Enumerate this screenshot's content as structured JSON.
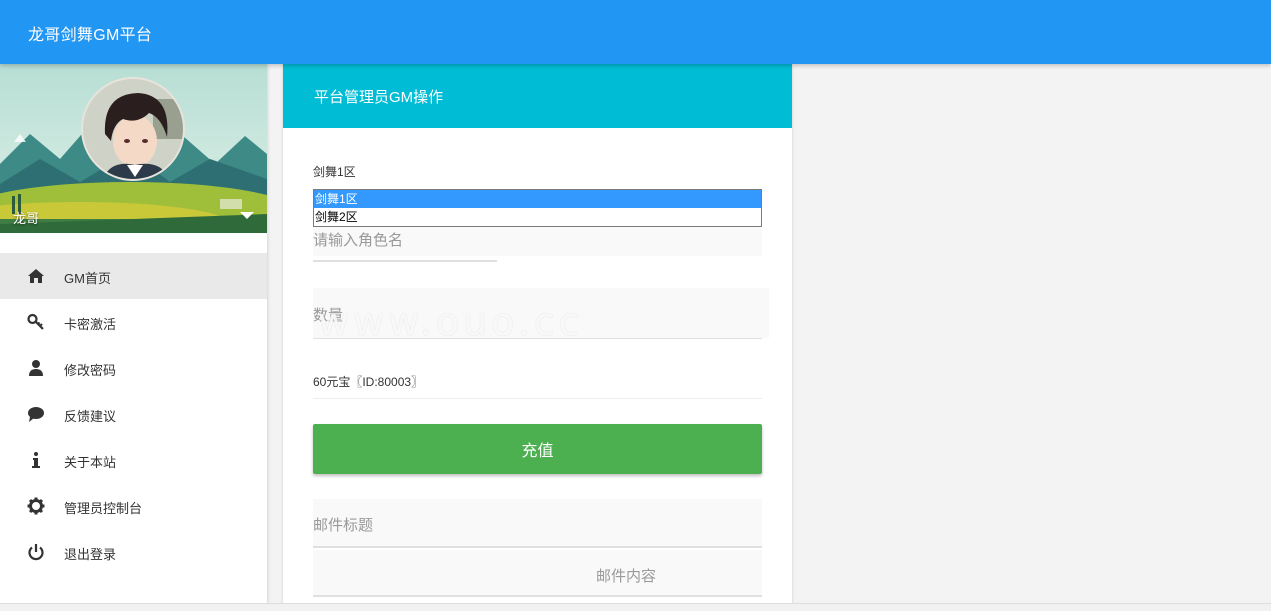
{
  "app": {
    "title": "龙哥剑舞GM平台"
  },
  "profile": {
    "name": "龙哥"
  },
  "nav": [
    {
      "label": "GM首页",
      "icon": "home-icon",
      "active": true
    },
    {
      "label": "卡密激活",
      "icon": "key-icon",
      "active": false
    },
    {
      "label": "修改密码",
      "icon": "user-icon",
      "active": false
    },
    {
      "label": "反馈建议",
      "icon": "comment-icon",
      "active": false
    },
    {
      "label": "关于本站",
      "icon": "info-icon",
      "active": false
    },
    {
      "label": "管理员控制台",
      "icon": "gear-icon",
      "active": false
    },
    {
      "label": "退出登录",
      "icon": "power-icon",
      "active": false
    }
  ],
  "card": {
    "title": "平台管理员GM操作",
    "server_label": "剑舞1区",
    "servers": [
      "剑舞1区",
      "剑舞2区"
    ],
    "role_placeholder": "请输入角色名",
    "quantity_placeholder": "数量",
    "item_selected": "60元宝〖ID:80003〗",
    "recharge_label": "充值",
    "mail_title_placeholder": "邮件标题",
    "mail_content_placeholder": "邮件内容"
  },
  "watermark": "www.ouo.cc",
  "colors": {
    "topbar": "#2196f3",
    "card_header": "#00bcd4",
    "recharge_button": "#4caf50",
    "selected_option": "#3399ff"
  }
}
